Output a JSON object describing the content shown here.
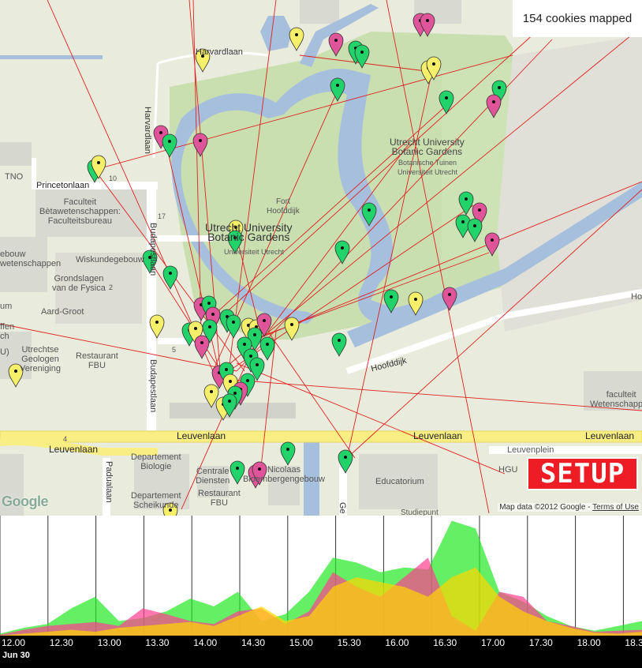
{
  "status": {
    "cookie_count_text": "154 cookies mapped"
  },
  "map": {
    "labels": {
      "harvardlaan": "Harvardlaan",
      "harvardlaan_v": "Harvardlaan",
      "tno": "TNO",
      "princetonlaan": "Princetonlaan",
      "faculteit_bw": "Faculteit\nBètawetenschappen:\nFaculteitsbureau",
      "ebouw": "ebouw\nwetenschappen",
      "wiskundegebouw": "Wiskundegebouw",
      "grondslagen": "Grondslagen\nvan de Fysica",
      "aard_groot": "Aard-Groot",
      "um": "um",
      "faffen": "ffen\nch",
      "u": "U)",
      "utrechtse_geologen": "Utrechtse\nGeologen\nVereniging",
      "restaurant_fbu": "Restaurant\nFBU",
      "budapestlaan_top": "Budapestlaan",
      "budapestlaan_bottom": "Budapestlaan",
      "botanic_main": "Utrecht University\nBotanic Gardens",
      "universiteit_utrecht": "Universiteit Utrecht",
      "fort_hoofddijk": "Fort\nHoofddijk",
      "botanic_ne": "Utrecht University\nBotanic Gardens",
      "botanische_tuinen": "Botanische Tuinen\nUniversiteit Utrecht",
      "hoofddijk": "Hoofddijk",
      "hoo": "Hoo",
      "faculteit_w": "faculteit\nWetenschappen",
      "leuvenlaan_1": "Leuvenlaan",
      "leuvenlaan_2": "Leuvenlaan",
      "leuvenlaan_3": "Leuvenlaan",
      "leuvenlaan_4": "Leuvenlaan",
      "departement_biologie": "Departement\nBiologie",
      "departement_scheikunde": "Departement\nScheikunde",
      "centrale_diensten": "Centrale\nDiensten",
      "restaurant_fbu_2": "Restaurant\nFBU",
      "nicolaas": "Nicolaas\nBloembergengebouw",
      "padualaan": "Padualaan",
      "educatorium": "Educatorium",
      "leuvenplein": "Leuvenplein",
      "hgu": "HGU",
      "studiepunt": "Studiepunt",
      "ge": "Ge",
      "num_10": "10",
      "num_17": "17",
      "num_2": "2",
      "num_5": "5",
      "num_4": "4"
    },
    "google_logo": "Google",
    "attribution": {
      "prefix": "Map data ©2012 Google - ",
      "link": "Terms of Use"
    },
    "setup_logo": "SETUP",
    "colors": {
      "green": "#22d36a",
      "pink": "#e0559a",
      "yellow": "#f5ef6a",
      "line": "#e02020",
      "water": "#a5bfdd",
      "park": "#c9dfb0",
      "road_yellow": "#f8ee84"
    }
  },
  "timeline": {
    "date_label": "Jun 30",
    "tick_labels": [
      "12.00",
      "12.30",
      "13.00",
      "13.30",
      "14.00",
      "14.30",
      "15.00",
      "15.30",
      "16.00",
      "16.30",
      "17.00",
      "17.30",
      "18.00",
      "18.3"
    ]
  },
  "chart_data": {
    "type": "area",
    "x": [
      "12.00",
      "12.15",
      "12.30",
      "12.45",
      "13.00",
      "13.15",
      "13.30",
      "13.45",
      "14.00",
      "14.15",
      "14.30",
      "14.45",
      "15.00",
      "15.15",
      "15.30",
      "15.45",
      "16.00",
      "16.15",
      "16.30",
      "16.45",
      "17.00",
      "17.15",
      "17.30",
      "17.45",
      "18.00",
      "18.15",
      "18.30",
      "18.40"
    ],
    "series": [
      {
        "color": "#22e822",
        "values": [
          2,
          8,
          12,
          28,
          40,
          15,
          18,
          25,
          38,
          30,
          45,
          15,
          22,
          45,
          80,
          75,
          65,
          70,
          68,
          118,
          110,
          45,
          35,
          20,
          10,
          5,
          10,
          15
        ]
      },
      {
        "color": "#ff3f8f",
        "values": [
          1,
          6,
          10,
          12,
          14,
          10,
          28,
          22,
          15,
          12,
          25,
          28,
          12,
          25,
          65,
          50,
          40,
          60,
          80,
          20,
          5,
          45,
          40,
          15,
          10,
          4,
          5,
          6
        ]
      },
      {
        "color": "#ffd700",
        "values": [
          0,
          2,
          4,
          6,
          4,
          8,
          10,
          12,
          14,
          10,
          20,
          30,
          15,
          20,
          50,
          60,
          55,
          50,
          40,
          60,
          70,
          40,
          25,
          15,
          8,
          3,
          2,
          4
        ]
      }
    ]
  }
}
